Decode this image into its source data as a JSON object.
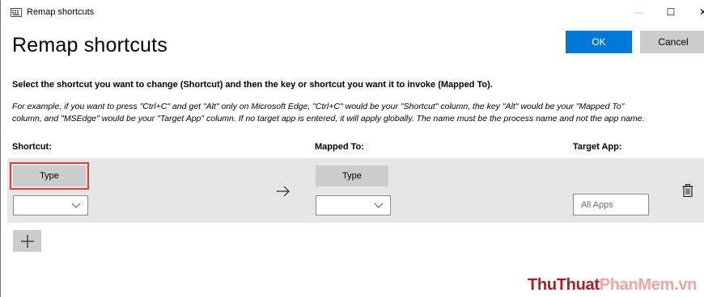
{
  "window": {
    "title": "Remap shortcuts",
    "minimize_glyph": "—",
    "maximize_glyph": "☐",
    "close_glyph": "✕"
  },
  "header": {
    "title": "Remap shortcuts",
    "ok_label": "OK",
    "cancel_label": "Cancel"
  },
  "instructions": "Select the shortcut you want to change (Shortcut) and then the key or shortcut you want it to invoke (Mapped To).",
  "example": {
    "line1": "For example, if you want to press \"Ctrl+C\" and get \"Alt\" only on Microsoft Edge, \"Ctrl+C\" would be your \"Shortcut\" column, the key \"Alt\" would be your \"Mapped To\"",
    "line2": "column, and \"MSEdge\" would be your \"Target App\" column. If no target app is entered, it will apply globally. The name must be the process name and not the app name."
  },
  "columns": {
    "shortcut": "Shortcut:",
    "mapped_to": "Mapped To:",
    "target_app": "Target App:"
  },
  "row": {
    "shortcut_type_label": "Type",
    "shortcut_dropdown_value": "",
    "mapped_type_label": "Type",
    "mapped_dropdown_value": "",
    "target_app_placeholder": "All Apps",
    "arrow_icon": "arrow-right-icon",
    "delete_icon": "trash-icon"
  },
  "add_button_icon": "plus-icon",
  "watermark": {
    "part1": "ThuThuat",
    "part2": "PhanMem",
    "part3": ".vn"
  },
  "colors": {
    "accent": "#0078d7",
    "highlight_outline": "#e5393b",
    "row_background": "#e6e6e6",
    "button_gray": "#cccccc"
  }
}
